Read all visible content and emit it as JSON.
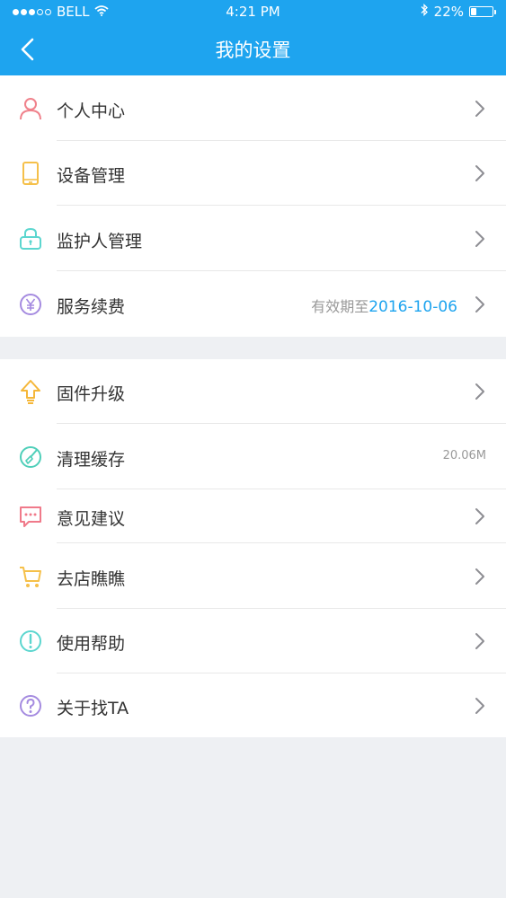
{
  "status_bar": {
    "carrier": "BELL",
    "time": "4:21 PM",
    "battery": "22%",
    "battery_level": 0.22,
    "signal_bars_filled": 3,
    "signal_bars_total": 5
  },
  "nav": {
    "title": "我的设置",
    "back_icon": "chevron-left-icon"
  },
  "colors": {
    "primary": "#1ea4ef",
    "background": "#eef0f3",
    "text": "#333333",
    "muted": "#999999"
  },
  "group1": [
    {
      "label": "个人中心",
      "icon": "person-icon",
      "icon_color": "#f0828c"
    },
    {
      "label": "设备管理",
      "icon": "phone-icon",
      "icon_color": "#f5c04a"
    },
    {
      "label": "监护人管理",
      "icon": "lock-icon",
      "icon_color": "#5cd6cf"
    },
    {
      "label": "服务续费",
      "icon": "yen-icon",
      "icon_color": "#a58be0",
      "value_prefix": "有效期至",
      "value_date": "2016-10-06"
    }
  ],
  "group2": [
    {
      "label": "固件升级",
      "icon": "upgrade-arrow-icon",
      "icon_color": "#f5b73a"
    },
    {
      "label": "清理缓存",
      "icon": "broom-icon",
      "icon_color": "#4fcfb9",
      "value": "20.06M"
    },
    {
      "label": "意见建议",
      "icon": "chat-bubble-icon",
      "icon_color": "#f07a8a"
    },
    {
      "label": "去店瞧瞧",
      "icon": "cart-icon",
      "icon_color": "#f5c04a"
    },
    {
      "label": "使用帮助",
      "icon": "exclamation-icon",
      "icon_color": "#5cd6cf"
    },
    {
      "label": "关于找TA",
      "icon": "question-icon",
      "icon_color": "#a58be0"
    }
  ]
}
